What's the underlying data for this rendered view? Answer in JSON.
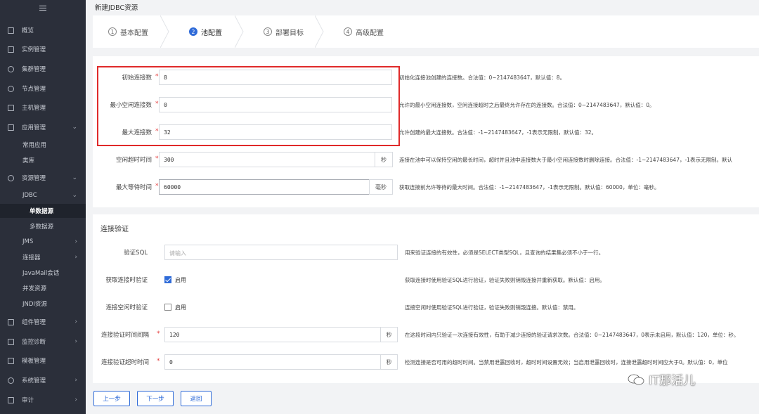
{
  "sidebar": {
    "items": [
      {
        "label": "概览",
        "icon": "grid-icon"
      },
      {
        "label": "实例管理",
        "icon": "instance-icon"
      },
      {
        "label": "集群管理",
        "icon": "cluster-icon"
      },
      {
        "label": "节点管理",
        "icon": "node-icon"
      },
      {
        "label": "主机管理",
        "icon": "host-icon"
      },
      {
        "label": "应用管理",
        "icon": "app-icon",
        "expanded": true
      },
      {
        "label": "常用应用",
        "sub": true
      },
      {
        "label": "类库",
        "sub": true
      },
      {
        "label": "资源管理",
        "icon": "resource-icon",
        "expanded": true
      },
      {
        "label": "JDBC",
        "sub": true,
        "expanded": true
      },
      {
        "label": "单数据源",
        "sub2": true,
        "active": true
      },
      {
        "label": "多数据源",
        "sub2": true
      },
      {
        "label": "JMS",
        "sub": true
      },
      {
        "label": "连接器",
        "sub": true
      },
      {
        "label": "JavaMail会话",
        "sub": true
      },
      {
        "label": "并发资源",
        "sub": true
      },
      {
        "label": "JNDI资源",
        "sub": true
      },
      {
        "label": "组件管理",
        "icon": "component-icon"
      },
      {
        "label": "监控诊断",
        "icon": "monitor-icon"
      },
      {
        "label": "模板管理",
        "icon": "template-icon"
      },
      {
        "label": "系统管理",
        "icon": "system-icon"
      },
      {
        "label": "审计",
        "icon": "audit-icon"
      }
    ]
  },
  "page_title": "新建JDBC资源",
  "steps": [
    {
      "num": "1",
      "label": "基本配置"
    },
    {
      "num": "2",
      "label": "池配置",
      "active": true
    },
    {
      "num": "3",
      "label": "部署目标"
    },
    {
      "num": "4",
      "label": "高级配置"
    }
  ],
  "pool": {
    "initial": {
      "label": "初始连接数",
      "value": "8",
      "desc": "初始化连接池创建的连接数。合法值：0~2147483647，默认值：8。"
    },
    "min_idle": {
      "label": "最小空闲连接数",
      "value": "0",
      "desc": "允许的最小空闲连接数，空闲连接超时之后最终允许存在的连接数。合法值：0~2147483647，默认值：0。"
    },
    "max": {
      "label": "最大连接数",
      "value": "32",
      "desc": "允许创建的最大连接数。合法值：-1~2147483647，-1表示无限制，默认值：32。"
    },
    "idle_timeout": {
      "label": "空闲超时时间",
      "value": "300",
      "unit": "秒",
      "desc": "连接在池中可以保持空闲的最长时间，超时并且池中连接数大于最小空闲连接数时删除连接。合法值：-1~2147483647，-1表示无限制。默认"
    },
    "max_wait": {
      "label": "最大等待时间",
      "value": "60000",
      "unit": "毫秒",
      "desc": "获取连接前允许等待的最大时间。合法值：-1~2147483647，-1表示无限制。默认值：60000，单位：毫秒。"
    }
  },
  "validation": {
    "title": "连接验证",
    "sql": {
      "label": "验证SQL",
      "placeholder": "请输入",
      "desc": "用来验证连接的有效性，必须是SELECT类型SQL，且查询的结果集必须不小于一行。"
    },
    "on_get": {
      "label": "获取连接时验证",
      "checked": true,
      "cb_label": "启用",
      "desc": "获取连接时使用验证SQL进行验证，验证失败则销毁连接并重新获取。默认值：启用。"
    },
    "on_idle": {
      "label": "连接空闲时验证",
      "checked": false,
      "cb_label": "启用",
      "desc": "连接空闲时使用验证SQL进行验证，验证失败则销毁连接。默认值：禁用。"
    },
    "interval": {
      "label": "连接验证时间间隔",
      "value": "120",
      "unit": "秒",
      "desc": "在这段时间内只验证一次连接有效性，有助于减少连接的验证请求次数。合法值：0~2147483647，0表示未启用，默认值：120，单位：秒。"
    },
    "timeout": {
      "label": "连接验证超时时间",
      "value": "0",
      "unit": "秒",
      "desc": "检测连接是否可用的超时时间。当禁用泄露回收时，超时时间设置无效；当启用泄露回收时，连接泄露超时时间应大于0。默认值：0，单位"
    }
  },
  "buttons": {
    "prev": "上一步",
    "next": "下一步",
    "back": "返回"
  },
  "watermark": "IT那活儿",
  "colors": {
    "accent": "#2f6bd8",
    "highlight": "#e02a2a",
    "sidebar_bg": "#2b2f3a",
    "required": "#e43b3b"
  }
}
